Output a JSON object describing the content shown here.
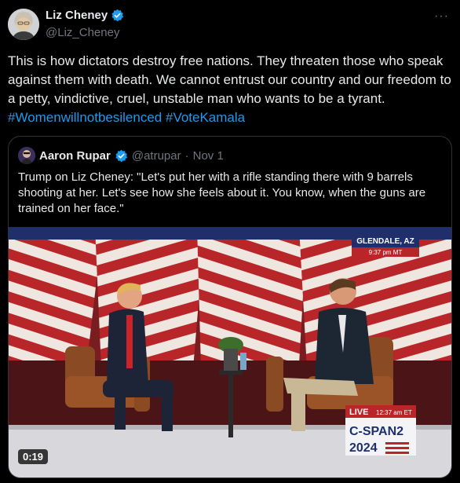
{
  "author": {
    "display_name": "Liz Cheney",
    "handle": "@Liz_Cheney",
    "verified_icon": "verified-badge-icon",
    "badge_color": "#1d9bf0"
  },
  "more_label": "···",
  "tweet": {
    "text": "This is how dictators destroy free nations. They threaten those who speak against them with death. We cannot entrust our country and our freedom to a petty, vindictive, cruel, unstable man who wants to be a tyrant.",
    "hashtags": [
      "#Womenwillnotbesilenced",
      "#VoteKamala"
    ]
  },
  "quote": {
    "display_name": "Aaron Rupar",
    "handle": "@atrupar",
    "separator": "·",
    "date": "Nov 1",
    "text": "Trump on Liz Cheney: \"Let's put her with a rifle standing there with 9 barrels shooting at her. Let's see how she feels about it. You know, when the guns are trained on her face.\""
  },
  "video": {
    "location": "GLENDALE, AZ",
    "local_time": "9:37 pm MT",
    "live_label": "LIVE",
    "live_time": "12:37 am ET",
    "network_line1": "C-SPAN2",
    "network_line2": "2024",
    "duration": "0:19"
  },
  "colors": {
    "background": "#000000",
    "text": "#e7e9ea",
    "secondary": "#71767b",
    "link": "#1d9bf0",
    "border": "#2f3336"
  }
}
